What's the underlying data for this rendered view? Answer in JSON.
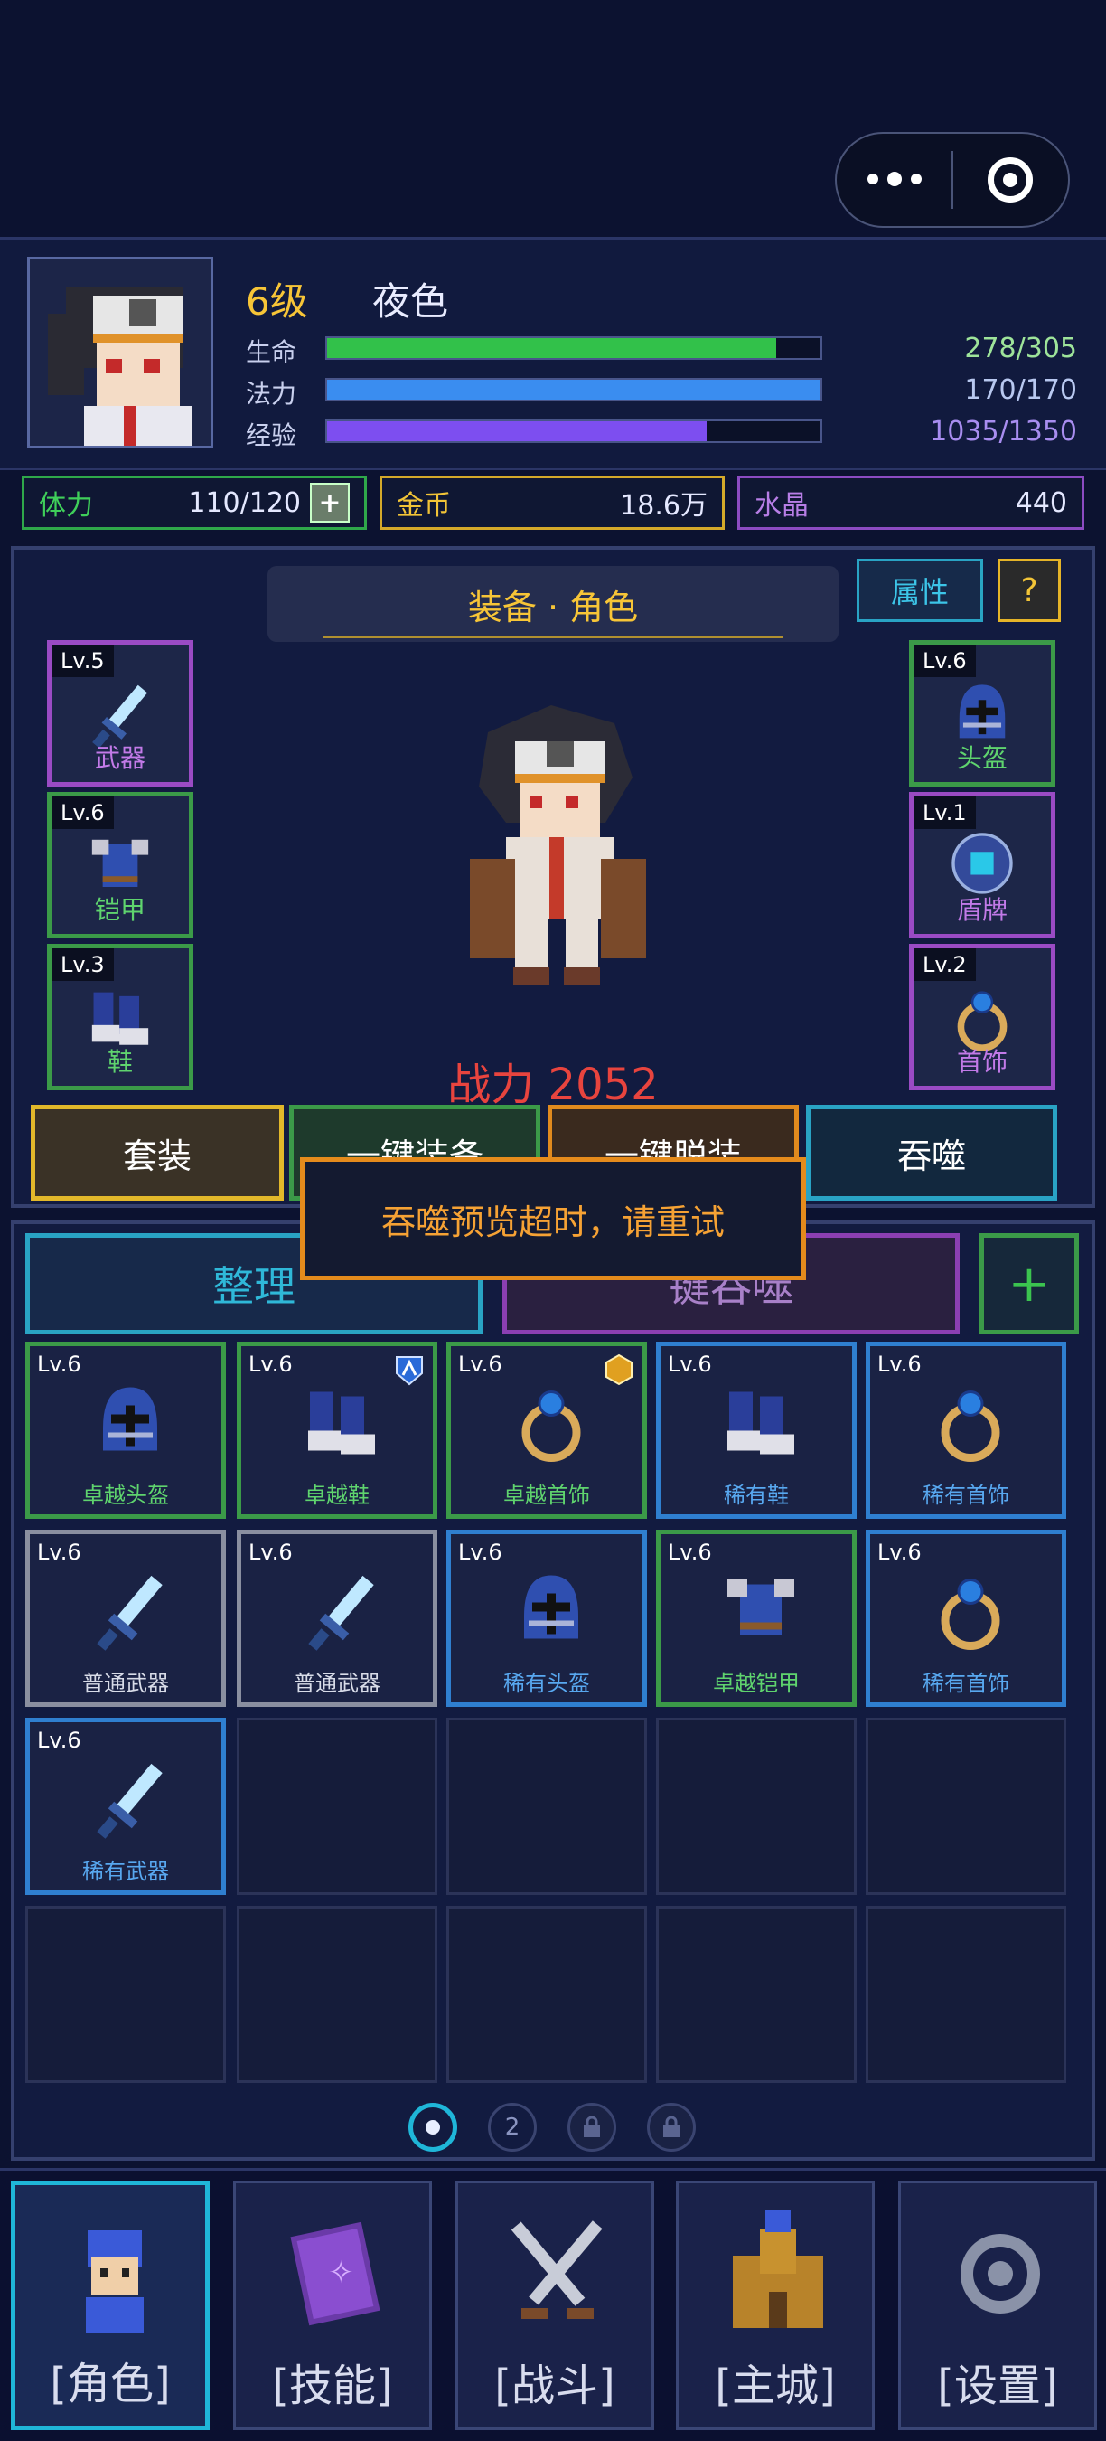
{
  "player": {
    "level": "6级",
    "name": "夜色",
    "stats": [
      {
        "label": "生命",
        "value": "278/305",
        "fraction": 0.91,
        "color": "#32c14a",
        "value_color": "#9ee49a"
      },
      {
        "label": "法力",
        "value": "170/170",
        "fraction": 1.0,
        "color": "#3a8df0",
        "value_color": "#b8c8f0"
      },
      {
        "label": "经验",
        "value": "1035/1350",
        "fraction": 0.77,
        "color": "#7d4ef0",
        "value_color": "#a88df0"
      }
    ]
  },
  "resources": {
    "stamina": {
      "label": "体力",
      "value": "110/120",
      "plus": "+"
    },
    "gold": {
      "label": "金币",
      "value": "18.6万"
    },
    "crystal": {
      "label": "水晶",
      "value": "440"
    }
  },
  "equip": {
    "title": "装备 · 角色",
    "attr_button": "属性",
    "help_button": "?",
    "left_slots": [
      {
        "lv": "Lv.5",
        "name": "武器",
        "icon": "sword-icon",
        "color": "#9a4bc4"
      },
      {
        "lv": "Lv.6",
        "name": "铠甲",
        "icon": "armor-icon",
        "color": "#3b9a48"
      },
      {
        "lv": "Lv.3",
        "name": "鞋",
        "icon": "boots-icon",
        "color": "#3b9a48"
      }
    ],
    "right_slots": [
      {
        "lv": "Lv.6",
        "name": "头盔",
        "icon": "helmet-icon",
        "color": "#3b9a48"
      },
      {
        "lv": "Lv.1",
        "name": "盾牌",
        "icon": "shield-icon",
        "color": "#9a4bc4"
      },
      {
        "lv": "Lv.2",
        "name": "首饰",
        "icon": "ring-icon",
        "color": "#9a4bc4"
      }
    ],
    "power": "战力 2052",
    "actions": {
      "set": "套装",
      "equip_all": "一键装备",
      "unequip_all": "一键脱装",
      "devour": "吞噬"
    }
  },
  "toast": "吞噬预览超时，请重试",
  "inventory": {
    "sort_button": "整理",
    "devour_button": "键吞噬",
    "expand_button": "+",
    "items": [
      {
        "lv": "Lv.6",
        "name": "卓越头盔",
        "icon": "helmet-icon",
        "rarity": "excellent"
      },
      {
        "lv": "Lv.6",
        "name": "卓越鞋",
        "icon": "boots-icon",
        "rarity": "excellent",
        "badge": "skill-badge-icon"
      },
      {
        "lv": "Lv.6",
        "name": "卓越首饰",
        "icon": "ring-icon",
        "rarity": "excellent",
        "badge": "gem-badge-icon"
      },
      {
        "lv": "Lv.6",
        "name": "稀有鞋",
        "icon": "boots-icon",
        "rarity": "rare"
      },
      {
        "lv": "Lv.6",
        "name": "稀有首饰",
        "icon": "ring-icon",
        "rarity": "rare"
      },
      {
        "lv": "Lv.6",
        "name": "普通武器",
        "icon": "sword-icon",
        "rarity": "common"
      },
      {
        "lv": "Lv.6",
        "name": "普通武器",
        "icon": "sword-icon",
        "rarity": "common"
      },
      {
        "lv": "Lv.6",
        "name": "稀有头盔",
        "icon": "helmet-icon",
        "rarity": "rare"
      },
      {
        "lv": "Lv.6",
        "name": "卓越铠甲",
        "icon": "armor-icon",
        "rarity": "excellent"
      },
      {
        "lv": "Lv.6",
        "name": "稀有首饰",
        "icon": "ring-icon",
        "rarity": "rare"
      },
      {
        "lv": "Lv.6",
        "name": "稀有武器",
        "icon": "sword-icon",
        "rarity": "rare"
      }
    ],
    "rarity_colors": {
      "excellent": "#3b9a48",
      "rare": "#2f7fd0",
      "common": "#8a8fa0"
    },
    "rarity_text_colors": {
      "excellent": "#5fd46e",
      "rare": "#58a8f0",
      "common": "#d8dce8"
    },
    "pages": [
      "",
      "2",
      "lock-icon",
      "lock-icon"
    ]
  },
  "nav": [
    {
      "label": "[角色]",
      "icon": "hero-icon",
      "active": true
    },
    {
      "label": "[技能]",
      "icon": "spellbook-icon",
      "active": false
    },
    {
      "label": "[战斗]",
      "icon": "crossed-swords-icon",
      "active": false
    },
    {
      "label": "[主城]",
      "icon": "castle-icon",
      "active": false
    },
    {
      "label": "[设置]",
      "icon": "gear-icon",
      "active": false
    }
  ]
}
